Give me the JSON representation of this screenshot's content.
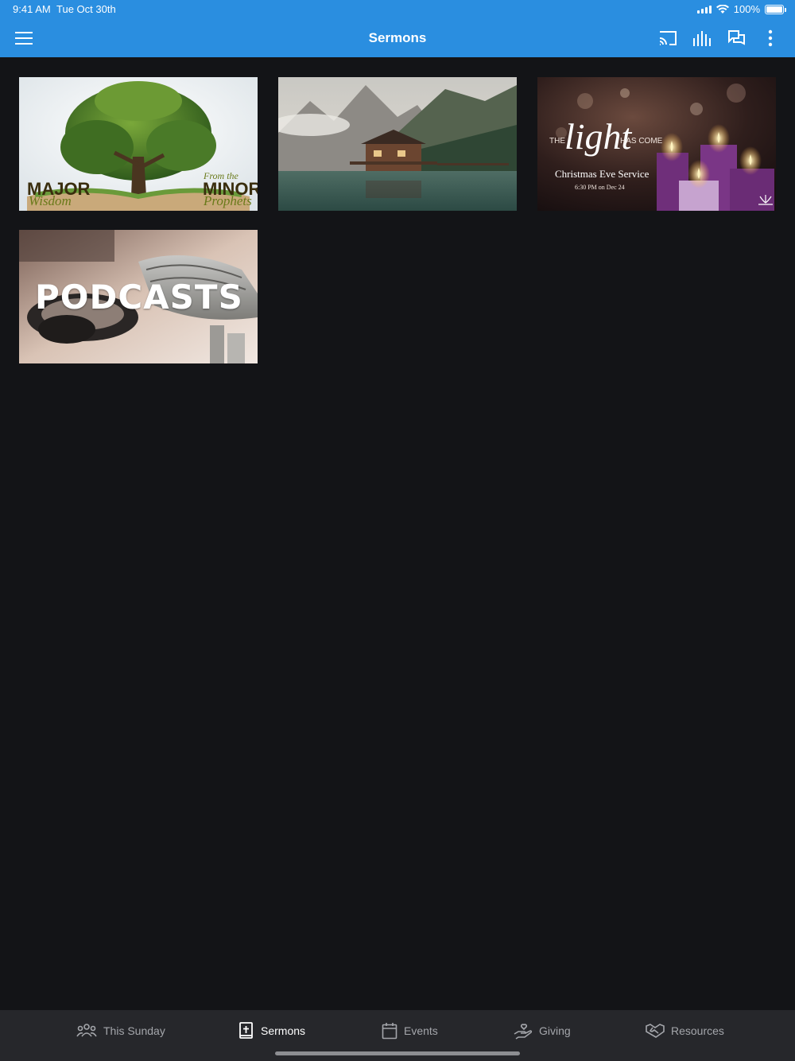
{
  "status_bar": {
    "time": "9:41 AM",
    "date": "Tue Oct 30th",
    "battery": "100%"
  },
  "app_bar": {
    "title": "Sermons",
    "icons": [
      "menu-icon",
      "cast-icon",
      "audio-bars-icon",
      "chat-icon",
      "more-vertical-icon"
    ]
  },
  "tiles": [
    {
      "id": "major-minor",
      "line1": "MAJOR",
      "line2": "Wisdom",
      "line3": "From the",
      "line4": "MINOR",
      "line5": "Prophets"
    },
    {
      "id": "lake-cabin"
    },
    {
      "id": "christmas-eve",
      "the": "THE",
      "light": "light",
      "has_come": "HAS COME",
      "service": "Christmas Eve Service",
      "time": "6:30 PM on Dec 24"
    },
    {
      "id": "podcasts",
      "text": "PODCASTS"
    }
  ],
  "bottom_nav": {
    "items": [
      {
        "label": "This Sunday",
        "icon": "group-icon",
        "active": false
      },
      {
        "label": "Sermons",
        "icon": "bible-icon",
        "active": true
      },
      {
        "label": "Events",
        "icon": "calendar-icon",
        "active": false
      },
      {
        "label": "Giving",
        "icon": "giving-hand-icon",
        "active": false
      },
      {
        "label": "Resources",
        "icon": "handshake-icon",
        "active": false
      }
    ]
  },
  "colors": {
    "app_bar": "#2a8ee0",
    "background": "#131417",
    "bottom_nav": "#26272b",
    "nav_inactive": "#a4a6ab"
  }
}
